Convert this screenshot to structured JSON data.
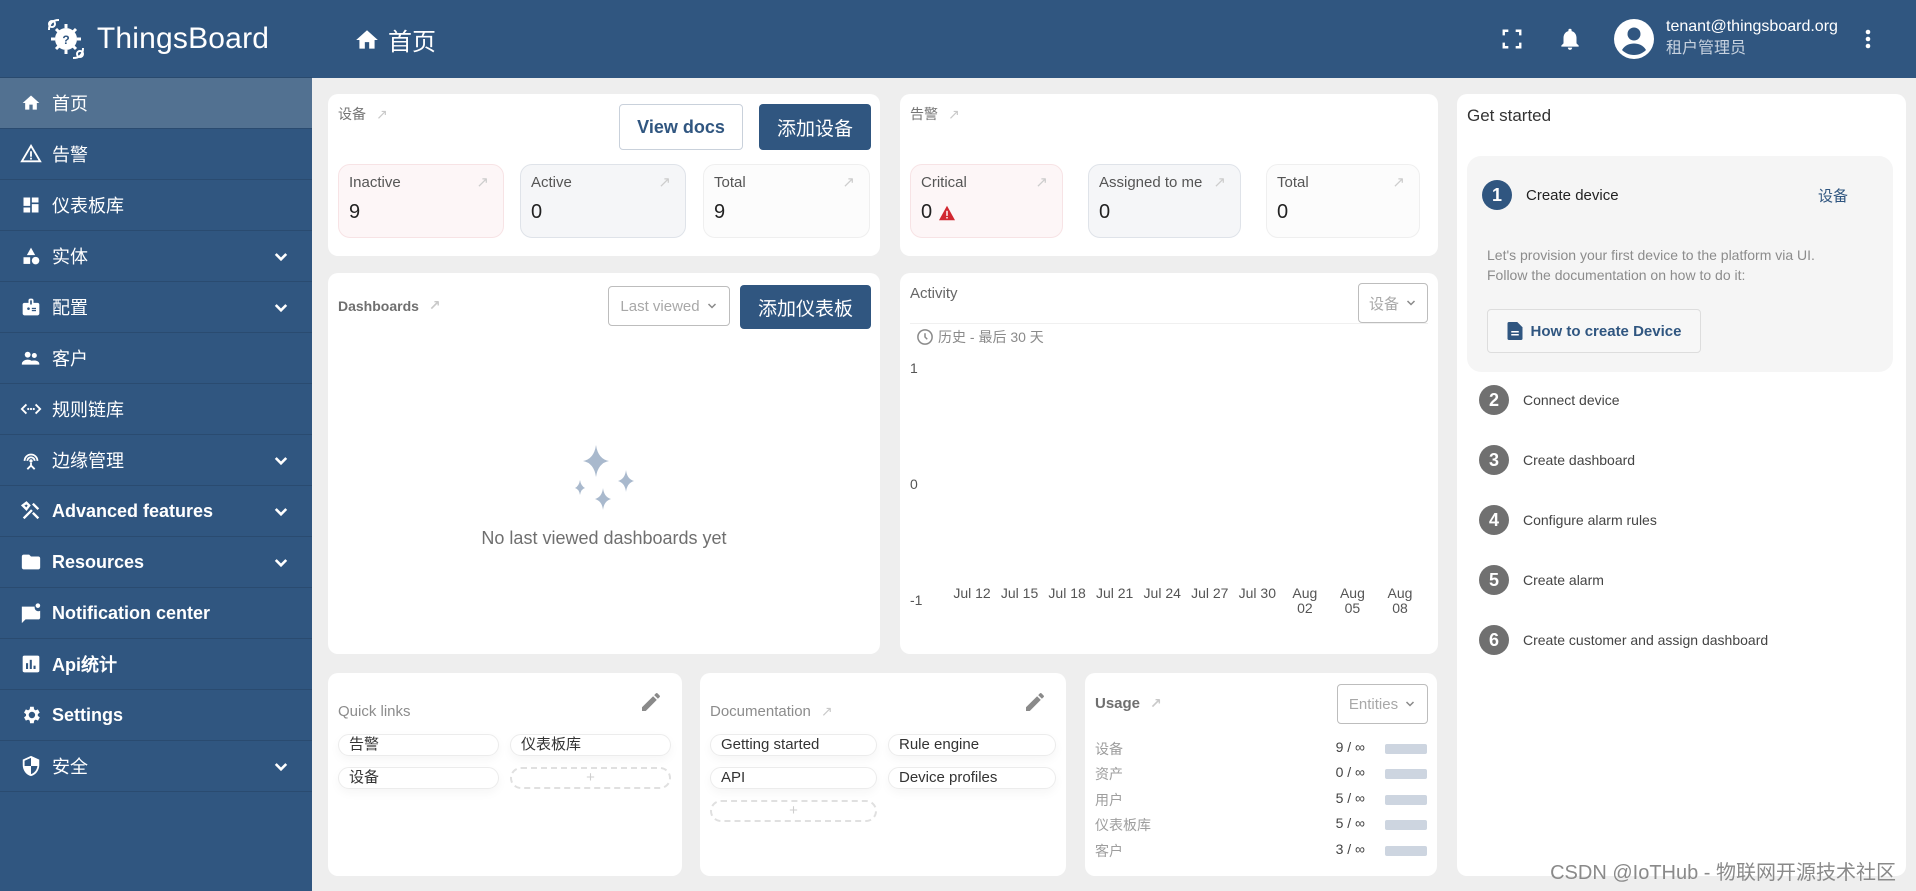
{
  "app": {
    "name": "ThingsBoard"
  },
  "sidebar": {
    "items": [
      {
        "label": "首页",
        "icon": "home-icon",
        "active": true,
        "expandable": false
      },
      {
        "label": "告警",
        "icon": "warning-icon",
        "active": false,
        "expandable": false
      },
      {
        "label": "仪表板库",
        "icon": "dashboard-icon",
        "active": false,
        "expandable": false
      },
      {
        "label": "实体",
        "icon": "category-icon",
        "active": false,
        "expandable": true
      },
      {
        "label": "配置",
        "icon": "badge-icon",
        "active": false,
        "expandable": true
      },
      {
        "label": "客户",
        "icon": "people-icon",
        "active": false,
        "expandable": false
      },
      {
        "label": "规则链库",
        "icon": "code-icon",
        "active": false,
        "expandable": false
      },
      {
        "label": "边缘管理",
        "icon": "router-icon",
        "active": false,
        "expandable": true
      },
      {
        "label": "Advanced features",
        "icon": "tools-icon",
        "active": false,
        "expandable": true
      },
      {
        "label": "Resources",
        "icon": "folder-icon",
        "active": false,
        "expandable": true
      },
      {
        "label": "Notification center",
        "icon": "notification-icon",
        "active": false,
        "expandable": false
      },
      {
        "label": "Api统计",
        "icon": "bar-chart-icon",
        "active": false,
        "expandable": false
      },
      {
        "label": "Settings",
        "icon": "gear-icon",
        "active": false,
        "expandable": false
      },
      {
        "label": "安全",
        "icon": "shield-icon",
        "active": false,
        "expandable": true
      }
    ]
  },
  "header": {
    "title": "首页",
    "user_email": "tenant@thingsboard.org",
    "user_role": "租户管理员"
  },
  "devices": {
    "title": "设备",
    "view_docs": "View docs",
    "add": "添加设备",
    "stats": [
      {
        "label": "Inactive",
        "value": "9"
      },
      {
        "label": "Active",
        "value": "0"
      },
      {
        "label": "Total",
        "value": "9"
      }
    ]
  },
  "alarms": {
    "title": "告警",
    "stats": [
      {
        "label": "Critical",
        "value": "0"
      },
      {
        "label": "Assigned to me",
        "value": "0"
      },
      {
        "label": "Total",
        "value": "0"
      }
    ],
    "critical_color": "#d12730"
  },
  "dashboards": {
    "title": "Dashboards",
    "select": "Last viewed",
    "add": "添加仪表板",
    "empty": "No last viewed dashboards yet"
  },
  "activity": {
    "title": "Activity",
    "select": "设备",
    "timewindow": "历史 - 最后 30 天"
  },
  "chart_data": {
    "type": "line",
    "title": "Activity",
    "xlabel": "",
    "ylabel": "",
    "ylim": [
      -1,
      1
    ],
    "yticks": [
      "1",
      "0",
      "-1"
    ],
    "xticks": [
      "Jul 12",
      "Jul 15",
      "Jul 18",
      "Jul 21",
      "Jul 24",
      "Jul 27",
      "Jul 30",
      "Aug 02",
      "Aug 05",
      "Aug 08"
    ],
    "series": []
  },
  "get_started": {
    "title": "Get started",
    "steps": [
      {
        "num": "1",
        "label": "Create device",
        "active": true,
        "link": "设备",
        "desc_line1": "Let's provision your first device to the platform via UI.",
        "desc_line2": "Follow the documentation on how to do it:",
        "button": "How to create Device"
      },
      {
        "num": "2",
        "label": "Connect device"
      },
      {
        "num": "3",
        "label": "Create dashboard"
      },
      {
        "num": "4",
        "label": "Configure alarm rules"
      },
      {
        "num": "5",
        "label": "Create alarm"
      },
      {
        "num": "6",
        "label": "Create customer and assign dashboard"
      }
    ]
  },
  "quick_links": {
    "title": "Quick links",
    "links": [
      "告警",
      "仪表板库",
      "设备"
    ],
    "add": "+"
  },
  "documentation": {
    "title": "Documentation",
    "links": [
      "Getting started",
      "Rule engine",
      "API",
      "Device profiles"
    ],
    "add": "+"
  },
  "usage": {
    "title": "Usage",
    "select": "Entities",
    "rows": [
      {
        "name": "设备",
        "value": "9 / ∞"
      },
      {
        "name": "资产",
        "value": "0 / ∞"
      },
      {
        "name": "用户",
        "value": "5 / ∞"
      },
      {
        "name": "仪表板库",
        "value": "5 / ∞"
      },
      {
        "name": "客户",
        "value": "3 / ∞"
      }
    ]
  },
  "watermark": "CSDN @IoTHub - 物联网开源技术社区"
}
